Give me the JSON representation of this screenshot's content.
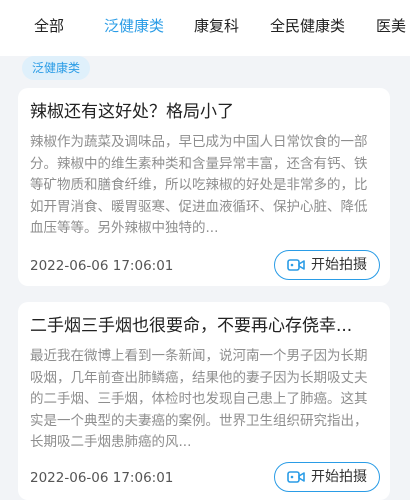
{
  "tabs": [
    {
      "label": "全部",
      "active": false
    },
    {
      "label": "泛健康类",
      "active": true
    },
    {
      "label": "康复科",
      "active": false
    },
    {
      "label": "全民健康类",
      "active": false
    },
    {
      "label": "医美",
      "active": false
    }
  ],
  "filter_chip": "泛健康类",
  "articles": [
    {
      "title": "辣椒还有这好处？格局小了",
      "summary": "辣椒作为蔬菜及调味品，早已成为中国人日常饮食的一部分。辣椒中的维生素种类和含量异常丰富，还含有钙、铁等矿物质和膳食纤维，所以吃辣椒的好处是非常多的，比如开胃消食、暖胃驱寒、促进血液循环、保护心脏、降低血压等等。另外辣椒中独特的...",
      "time": "2022-06-06 17:06:01",
      "action_label": "开始拍摄"
    },
    {
      "title": "二手烟三手烟也很要命，不要再心存侥幸...",
      "summary": "最近我在微博上看到一条新闻，说河南一个男子因为长期吸烟，几年前查出肺鳞癌，结果他的妻子因为长期吸丈夫的二手烟、三手烟，体检时也发现自己患上了肺癌。这其实是一个典型的夫妻癌的案例。世界卫生组织研究指出，长期吸二手烟患肺癌的风...",
      "time": "2022-06-06 17:06:01",
      "action_label": "开始拍摄"
    }
  ],
  "colors": {
    "accent": "#2a9ce6",
    "chip_bg": "#dff0fb",
    "page_bg": "#f2f4f7"
  }
}
